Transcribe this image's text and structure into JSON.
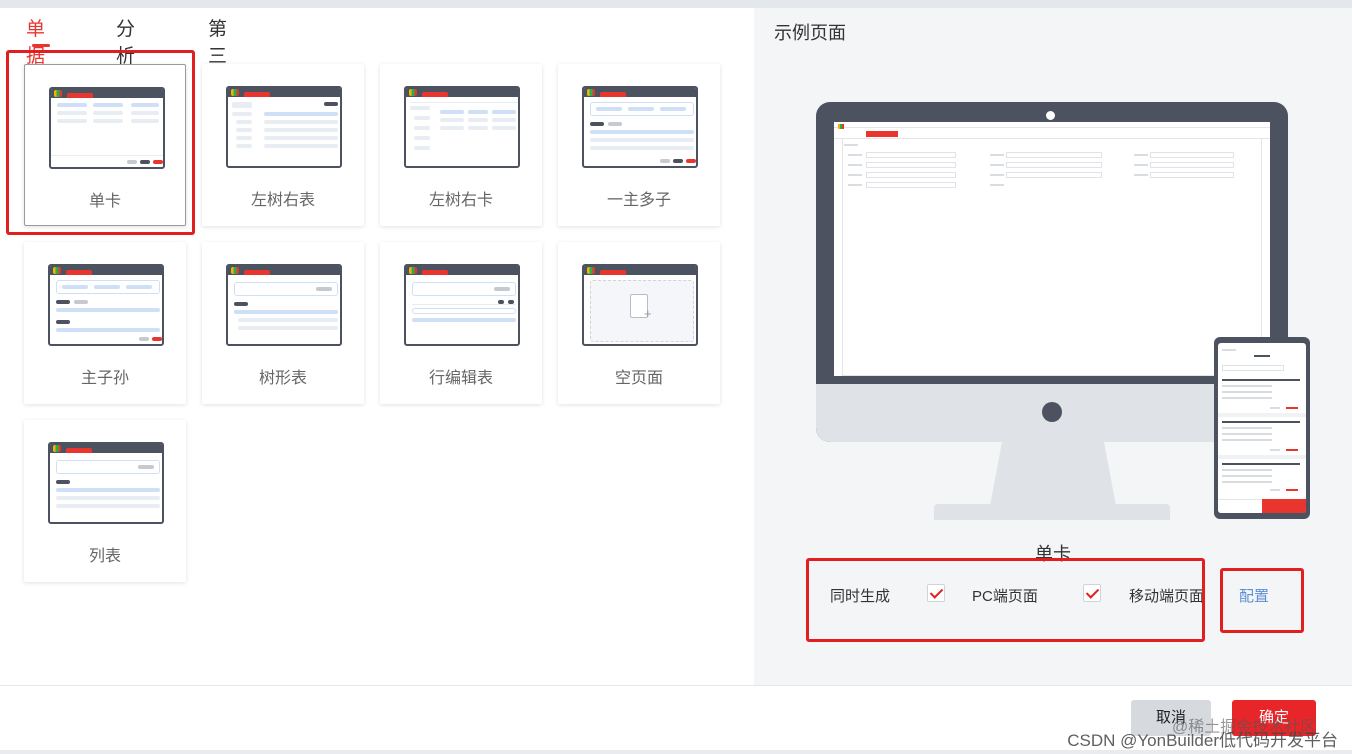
{
  "tabs": [
    "单据",
    "分析",
    "第三方"
  ],
  "active_tab": "单据",
  "templates": [
    {
      "label": "单卡",
      "selected": true
    },
    {
      "label": "左树右表"
    },
    {
      "label": "左树右卡"
    },
    {
      "label": "一主多子"
    },
    {
      "label": "主子孙"
    },
    {
      "label": "树形表"
    },
    {
      "label": "行编辑表"
    },
    {
      "label": "空页面"
    },
    {
      "label": "列表"
    }
  ],
  "preview": {
    "title": "示例页面",
    "name": "单卡"
  },
  "options": {
    "same_time_label": "同时生成",
    "pc_label": "PC端页面",
    "pc_checked": true,
    "mobile_label": "移动端页面",
    "mobile_checked": true,
    "config_label": "配置"
  },
  "footer": {
    "cancel_label": "取消",
    "ok_label": "确定",
    "watermark": "CSDN @YonBuilder低代码开发平台",
    "watermark2": "@稀土掘金技术社区"
  },
  "colors": {
    "accent": "#e8362f",
    "link": "#5b8fd6",
    "frame": "#4d5261"
  }
}
